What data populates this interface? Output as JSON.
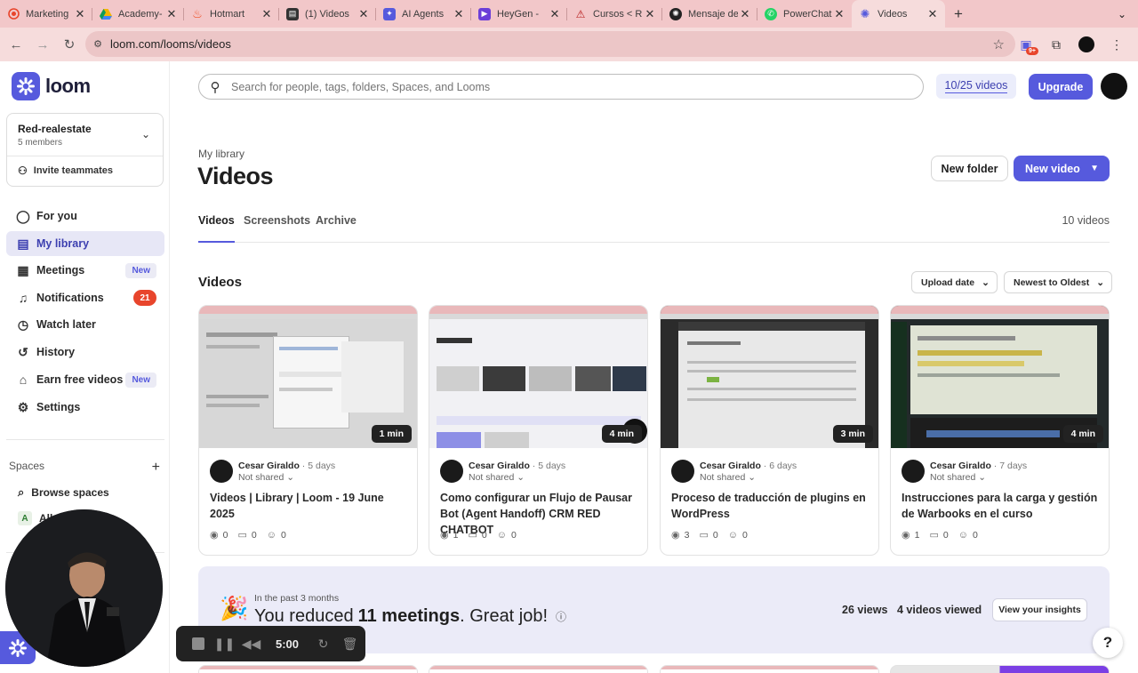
{
  "browser": {
    "tabs": [
      {
        "label": "",
        "icon": "record-icon",
        "color": "#e8452c"
      },
      {
        "label": "Marketing",
        "icon": "doc-icon",
        "color": "#333333"
      },
      {
        "label": "Academy-",
        "icon": "drive-icon",
        "color": "#f4b400"
      },
      {
        "label": "Hotmart",
        "icon": "flame-icon",
        "color": "#f04e23"
      },
      {
        "label": "(1) Videos",
        "icon": "doc-icon",
        "color": "#333333"
      },
      {
        "label": "AI Agents",
        "icon": "agents-icon",
        "color": "#565add"
      },
      {
        "label": "HeyGen -",
        "icon": "play-icon",
        "color": "#6b3fd8"
      },
      {
        "label": "Cursos < R",
        "icon": "triangle-icon",
        "color": "#b71c1c"
      },
      {
        "label": "Mensaje de",
        "icon": "openai-icon",
        "color": "#222222"
      },
      {
        "label": "PowerChat",
        "icon": "whatsapp-icon",
        "color": "#25d366"
      },
      {
        "label": "Videos",
        "icon": "loom-icon",
        "color": "#565add",
        "active": true
      }
    ],
    "url": "loom.com/looms/videos",
    "extension_badge": "9+"
  },
  "sidebar": {
    "brand": "loom",
    "workspace": {
      "name": "Red-realestate",
      "members": "5 members",
      "invite_label": "Invite teammates"
    },
    "items": [
      {
        "label": "For you",
        "icon": "user-icon"
      },
      {
        "label": "My library",
        "icon": "library-icon",
        "active": true
      },
      {
        "label": "Meetings",
        "icon": "calendar-icon",
        "pill": "New"
      },
      {
        "label": "Notifications",
        "icon": "bell-icon",
        "count": "21"
      },
      {
        "label": "Watch later",
        "icon": "clock-icon"
      },
      {
        "label": "History",
        "icon": "history-icon"
      },
      {
        "label": "Earn free videos",
        "icon": "gift-icon",
        "pill": "New"
      },
      {
        "label": "Settings",
        "icon": "gear-icon"
      }
    ],
    "spaces_label": "Spaces",
    "browse_spaces": "Browse spaces",
    "all_space_label": "All",
    "all_space_initial": "A"
  },
  "header": {
    "search_placeholder": "Search for people, tags, folders, Spaces, and Looms",
    "quota": "10/25 videos",
    "upgrade": "Upgrade"
  },
  "library": {
    "breadcrumb": "My library",
    "title": "Videos",
    "new_folder": "New folder",
    "new_video": "New video",
    "tabs": [
      "Videos",
      "Screenshots",
      "Archive"
    ],
    "video_count": "10 videos",
    "section_title": "Videos",
    "sort_upload": "Upload date",
    "sort_order": "Newest to Oldest"
  },
  "videos": [
    {
      "title": "Videos | Library | Loom - 19 June 2025",
      "author": "Cesar Giraldo",
      "age": "5 days",
      "shared": "Not shared",
      "duration": "1 min",
      "views": "0",
      "comments": "0",
      "reactions": "0"
    },
    {
      "title": "Como configurar un Flujo de Pausar Bot (Agent Handoff) CRM RED CHATBOT",
      "author": "Cesar Giraldo",
      "age": "5 days",
      "shared": "Not shared",
      "duration": "4 min",
      "views": "1",
      "comments": "0",
      "reactions": "0"
    },
    {
      "title": "Proceso de traducción de plugins en WordPress",
      "author": "Cesar Giraldo",
      "age": "6 days",
      "shared": "Not shared",
      "duration": "3 min",
      "views": "3",
      "comments": "0",
      "reactions": "0"
    },
    {
      "title": "Instrucciones para la carga y gestión de Warbooks en el curso",
      "author": "Cesar Giraldo",
      "age": "7 days",
      "shared": "Not shared",
      "duration": "4 min",
      "views": "1",
      "comments": "0",
      "reactions": "0"
    }
  ],
  "insights": {
    "period": "In the past 3 months",
    "reduced_prefix": "You reduced",
    "reduced_bold": "11 meetings",
    "reduced_suffix": ". Great job!",
    "views": "26 views",
    "videos_viewed": "4 videos viewed",
    "button": "View your insights"
  },
  "recorder": {
    "time": "5:00"
  },
  "help": "?",
  "colors": {
    "brand": "#565add",
    "tab_bar": "#f2c7c9",
    "notification": "#e8452c",
    "insights_bg": "#ebebf8"
  }
}
